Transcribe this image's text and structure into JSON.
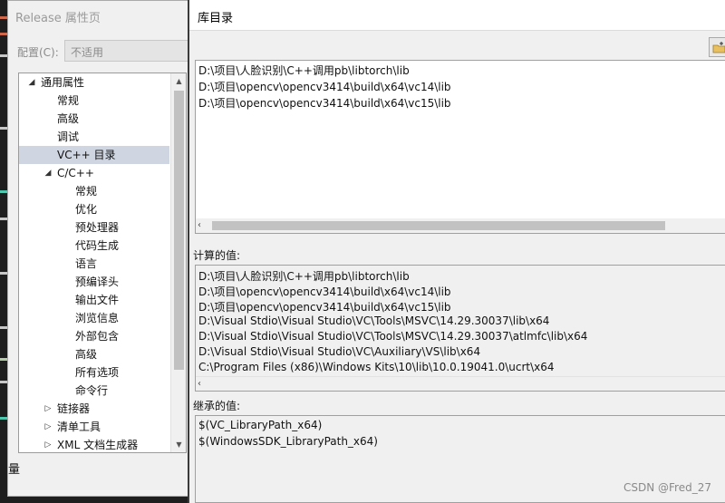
{
  "property_dialog": {
    "title": "Release 属性页",
    "config_label": "配置(C):",
    "config_value": "不适用",
    "tree": [
      {
        "label": "通用属性",
        "level": 0,
        "expand": "open"
      },
      {
        "label": "常规",
        "level": 1,
        "expand": "none"
      },
      {
        "label": "高级",
        "level": 1,
        "expand": "none"
      },
      {
        "label": "调试",
        "level": 1,
        "expand": "none"
      },
      {
        "label": "VC++ 目录",
        "level": 1,
        "expand": "none",
        "selected": true
      },
      {
        "label": "C/C++",
        "level": 1,
        "expand": "open"
      },
      {
        "label": "常规",
        "level": 2,
        "expand": "none"
      },
      {
        "label": "优化",
        "level": 2,
        "expand": "none"
      },
      {
        "label": "预处理器",
        "level": 2,
        "expand": "none"
      },
      {
        "label": "代码生成",
        "level": 2,
        "expand": "none"
      },
      {
        "label": "语言",
        "level": 2,
        "expand": "none"
      },
      {
        "label": "预编译头",
        "level": 2,
        "expand": "none"
      },
      {
        "label": "输出文件",
        "level": 2,
        "expand": "none"
      },
      {
        "label": "浏览信息",
        "level": 2,
        "expand": "none"
      },
      {
        "label": "外部包含",
        "level": 2,
        "expand": "none"
      },
      {
        "label": "高级",
        "level": 2,
        "expand": "none"
      },
      {
        "label": "所有选项",
        "level": 2,
        "expand": "none"
      },
      {
        "label": "命令行",
        "level": 2,
        "expand": "none"
      },
      {
        "label": "链接器",
        "level": 1,
        "expand": "closed"
      },
      {
        "label": "清单工具",
        "level": 1,
        "expand": "closed"
      },
      {
        "label": "XML 文档生成器",
        "level": 1,
        "expand": "closed"
      }
    ],
    "bottom_fragment": "量"
  },
  "library_dialog": {
    "title": "库目录",
    "entries": [
      "D:\\项目\\人脸识别\\C++调用pb\\libtorch\\lib",
      "D:\\项目\\opencv\\opencv3414\\build\\x64\\vc14\\lib",
      "D:\\项目\\opencv\\opencv3414\\build\\x64\\vc15\\lib"
    ],
    "computed_label": "计算的值:",
    "computed": [
      "D:\\项目\\人脸识别\\C++调用pb\\libtorch\\lib",
      "D:\\项目\\opencv\\opencv3414\\build\\x64\\vc14\\lib",
      "D:\\项目\\opencv\\opencv3414\\build\\x64\\vc15\\lib",
      "D:\\Visual Stdio\\Visual Studio\\VC\\Tools\\MSVC\\14.29.30037\\lib\\x64",
      "D:\\Visual Stdio\\Visual Studio\\VC\\Tools\\MSVC\\14.29.30037\\atlmfc\\lib\\x64",
      "D:\\Visual Stdio\\Visual Studio\\VC\\Auxiliary\\VS\\lib\\x64",
      "C:\\Program Files (x86)\\Windows Kits\\10\\lib\\10.0.19041.0\\ucrt\\x64"
    ],
    "inherited_label": "继承的值:",
    "inherited": [
      "$(VC_LibraryPath_x64)",
      "$(WindowsSDK_LibraryPath_x64)"
    ]
  },
  "watermark": "CSDN @Fred_27",
  "colors": {
    "selection": "#cfd6e2",
    "dialog_bg": "#f0f0f0",
    "editor_bg": "#1e1e1e"
  }
}
